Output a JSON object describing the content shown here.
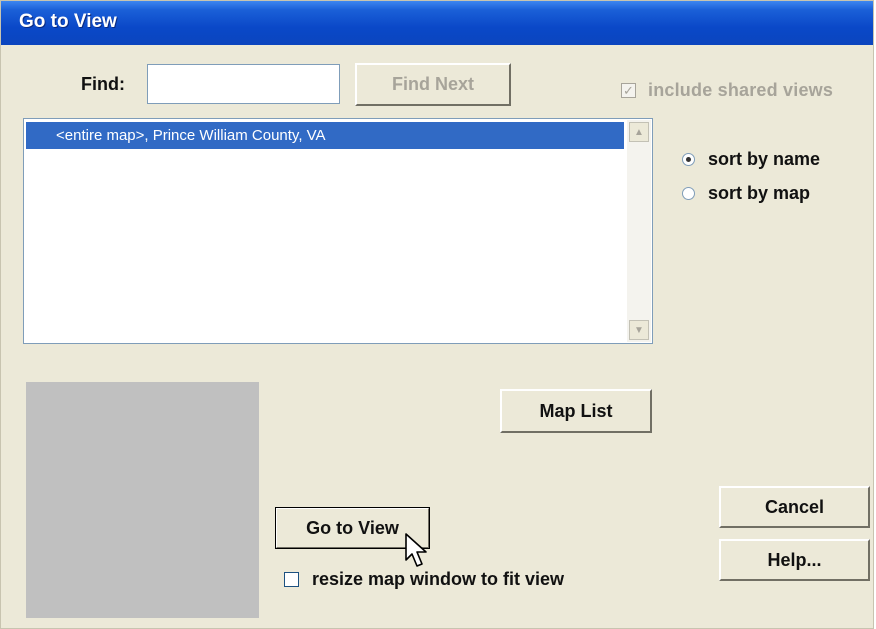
{
  "window": {
    "title": "Go to View"
  },
  "find": {
    "label": "Find:",
    "value": "",
    "find_next_label": "Find Next"
  },
  "include_shared": {
    "label": "include shared views",
    "checked": true,
    "enabled": false
  },
  "list": {
    "items": [
      {
        "label": "<entire map>, Prince William County, VA",
        "selected": true
      }
    ]
  },
  "sort": {
    "options": [
      {
        "label": "sort by name",
        "selected": true
      },
      {
        "label": "sort by map",
        "selected": false
      }
    ]
  },
  "buttons": {
    "map_list": "Map List",
    "go_to_view": "Go to View",
    "cancel": "Cancel",
    "help": "Help..."
  },
  "resize": {
    "label": "resize map window to fit view",
    "checked": false
  },
  "icons": {
    "scroll_up": "scroll-up-arrow-icon",
    "scroll_down": "scroll-down-arrow-icon",
    "cursor": "mouse-pointer-icon"
  },
  "colors": {
    "title_bar": "#0a48c8",
    "selection": "#316ac5",
    "dialog_bg": "#ece9d8"
  }
}
